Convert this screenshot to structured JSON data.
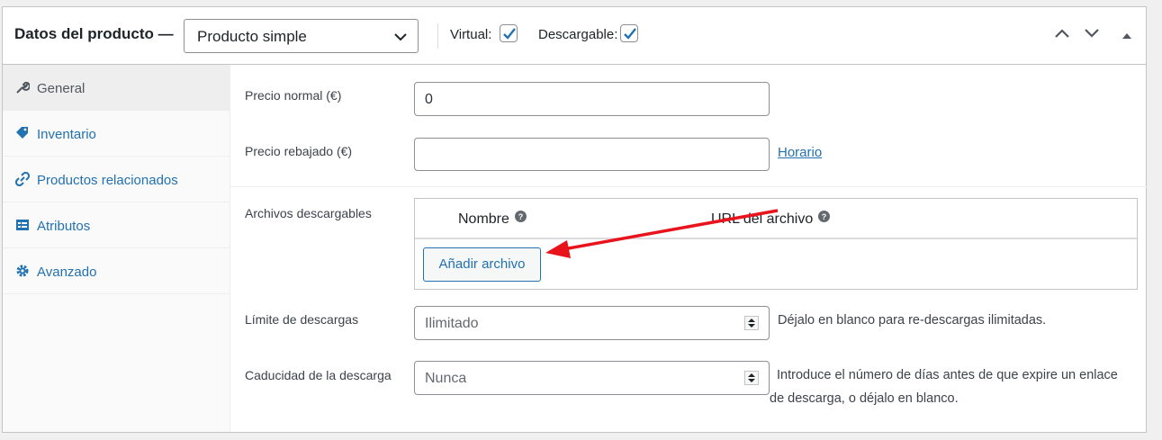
{
  "header": {
    "title": "Datos del producto —",
    "product_type": "Producto simple",
    "virtual_label": "Virtual:",
    "virtual_checked": true,
    "downloadable_label": "Descargable:",
    "downloadable_checked": true
  },
  "tabs": [
    {
      "label": "General",
      "icon": "wrench-icon",
      "active": true
    },
    {
      "label": "Inventario",
      "icon": "tag-icon",
      "active": false
    },
    {
      "label": "Productos relacionados",
      "icon": "link-icon",
      "active": false
    },
    {
      "label": "Atributos",
      "icon": "list-table-icon",
      "active": false
    },
    {
      "label": "Avanzado",
      "icon": "gear-icon",
      "active": false
    }
  ],
  "general": {
    "regular_price_label": "Precio normal (€)",
    "regular_price_value": "0",
    "sale_price_label": "Precio rebajado (€)",
    "sale_price_value": "",
    "schedule_link": "Horario",
    "downloadable_files_label": "Archivos descargables",
    "col_name": "Nombre",
    "col_url": "URL del archivo",
    "add_file_button": "Añadir archivo",
    "download_limit_label": "Límite de descargas",
    "download_limit_placeholder": "Ilimitado",
    "download_limit_hint": "Déjalo en blanco para re-descargas ilimitadas.",
    "download_expiry_label": "Caducidad de la descarga",
    "download_expiry_placeholder": "Nunca",
    "download_expiry_hint": "Introduce el número de días antes de que expire un enlace de descarga, o déjalo en blanco."
  },
  "colors": {
    "accent": "#2271b1",
    "annotation_arrow": "#e8131b"
  }
}
